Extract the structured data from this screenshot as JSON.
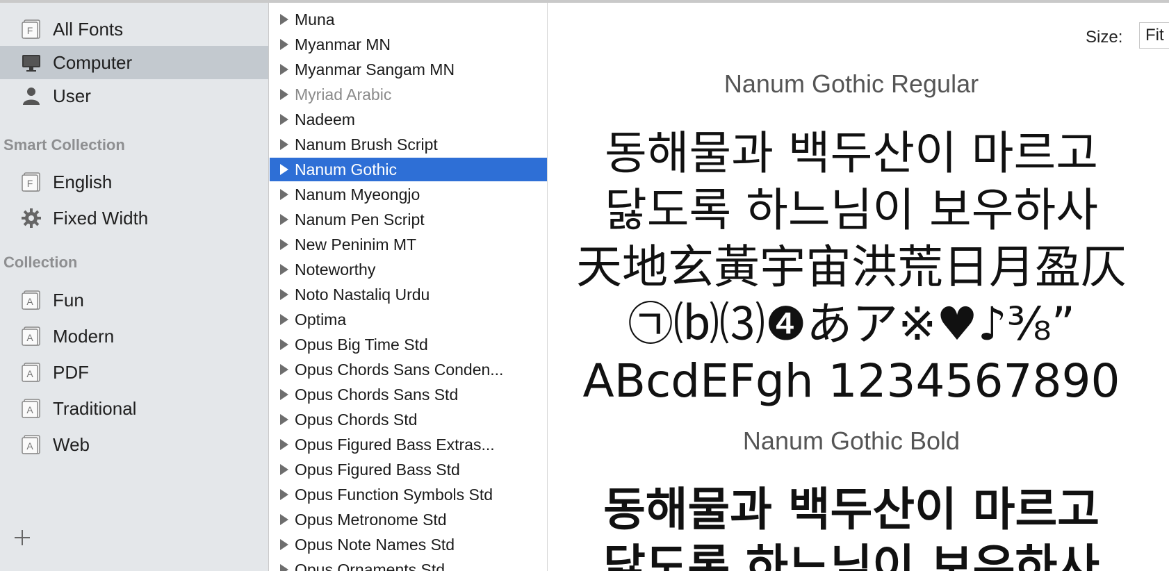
{
  "sidebar": {
    "items_top": [
      {
        "label": "All Fonts",
        "icon": "font-collection-icon"
      },
      {
        "label": "Computer",
        "icon": "computer-icon",
        "selected": true
      },
      {
        "label": "User",
        "icon": "user-icon"
      }
    ],
    "smart_collection_header": "Smart Collection",
    "smart_collection": [
      {
        "label": "English",
        "icon": "font-collection-icon"
      },
      {
        "label": "Fixed Width",
        "icon": "gear-icon"
      }
    ],
    "collection_header": "Collection",
    "collection": [
      {
        "label": "Fun",
        "icon": "collection-icon"
      },
      {
        "label": "Modern",
        "icon": "collection-icon"
      },
      {
        "label": "PDF",
        "icon": "collection-icon"
      },
      {
        "label": "Traditional",
        "icon": "collection-icon"
      },
      {
        "label": "Web",
        "icon": "collection-icon"
      }
    ],
    "add_button": "+"
  },
  "font_list": [
    {
      "name": "Muna"
    },
    {
      "name": "Myanmar MN"
    },
    {
      "name": "Myanmar Sangam MN"
    },
    {
      "name": "Myriad Arabic",
      "dim": true
    },
    {
      "name": "Nadeem"
    },
    {
      "name": "Nanum Brush Script"
    },
    {
      "name": "Nanum Gothic",
      "selected": true
    },
    {
      "name": "Nanum Myeongjo"
    },
    {
      "name": "Nanum Pen Script"
    },
    {
      "name": "New Peninim MT"
    },
    {
      "name": "Noteworthy"
    },
    {
      "name": "Noto Nastaliq Urdu"
    },
    {
      "name": "Optima"
    },
    {
      "name": "Opus Big Time Std"
    },
    {
      "name": "Opus Chords Sans Conden..."
    },
    {
      "name": "Opus Chords Sans Std"
    },
    {
      "name": "Opus Chords Std"
    },
    {
      "name": "Opus Figured Bass Extras..."
    },
    {
      "name": "Opus Figured Bass Std"
    },
    {
      "name": "Opus Function Symbols Std"
    },
    {
      "name": "Opus Metronome Std"
    },
    {
      "name": "Opus Note Names Std"
    },
    {
      "name": "Opus Ornaments Std"
    }
  ],
  "preview": {
    "size_label": "Size:",
    "size_value": "Fit",
    "regular_title": "Nanum Gothic Regular",
    "regular_lines": [
      "동해물과 백두산이 마르고",
      "닳도록 하느님이 보우하사",
      "天地玄黃宇宙洪荒日月盈仄",
      "㉠⒝⑶❹あア※♥♪⅜”",
      "ABcdEFgh 1234567890"
    ],
    "bold_title": "Nanum Gothic Bold",
    "bold_lines": [
      "동해물과 백두산이 마르고",
      "닳도록 하느님이 보우하사"
    ]
  },
  "colors": {
    "sidebar_bg": "#e4e7ea",
    "sidebar_selected": "#c3c9cf",
    "list_selected": "#2e6fd6"
  }
}
